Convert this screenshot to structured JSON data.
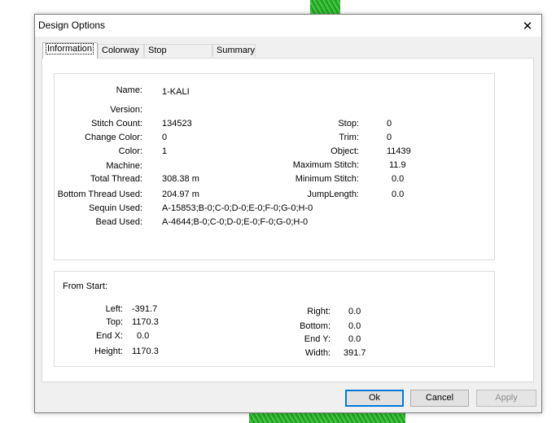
{
  "dialog": {
    "title": "Design Options",
    "close_glyph": "✕"
  },
  "tabs": [
    {
      "label": "Information"
    },
    {
      "label": "Colorway"
    },
    {
      "label": "Stop Sequence"
    },
    {
      "label": "Summary"
    }
  ],
  "info": {
    "name_label": "Name:",
    "name_value": "1-KALI",
    "version_label": "Version:",
    "version_value": "",
    "stitch_count_label": "Stitch Count:",
    "stitch_count_value": "134523",
    "change_color_label": "Change Color:",
    "change_color_value": "0",
    "color_label": "Color:",
    "color_value": "1",
    "machine_label": "Machine:",
    "machine_value": "",
    "total_thread_label": "Total Thread:",
    "total_thread_value": "308.38 m",
    "bottom_thread_label": "Bottom Thread Used:",
    "bottom_thread_value": "204.97 m",
    "sequin_label": "Sequin Used:",
    "sequin_value": "A-15853;B-0;C-0;D-0;E-0;F-0;G-0;H-0",
    "bead_label": "Bead Used:",
    "bead_value": "A-4644;B-0;C-0;D-0;E-0;F-0;G-0;H-0",
    "stop_label": "Stop:",
    "stop_value": "0",
    "trim_label": "Trim:",
    "trim_value": "0",
    "object_label": "Object:",
    "object_value": "11439",
    "max_stitch_label": "Maximum Stitch:",
    "max_stitch_value": "11.9",
    "min_stitch_label": "Minimum Stitch:",
    "min_stitch_value": "0.0",
    "jump_length_label": "JumpLength:",
    "jump_length_value": "0.0"
  },
  "from_start": {
    "heading": "From Start:",
    "left_label": "Left:",
    "left_value": "-391.7",
    "top_label": "Top:",
    "top_value": "1170.3",
    "endx_label": "End X:",
    "endx_value": "0.0",
    "height_label": "Height:",
    "height_value": "1170.3",
    "right_label": "Right:",
    "right_value": "0.0",
    "bottom_label": "Bottom:",
    "bottom_value": "0.0",
    "endy_label": "End Y:",
    "endy_value": "0.0",
    "width_label": "Width:",
    "width_value": "391.7"
  },
  "buttons": {
    "ok": "Ok",
    "cancel": "Cancel",
    "apply": "Apply"
  }
}
